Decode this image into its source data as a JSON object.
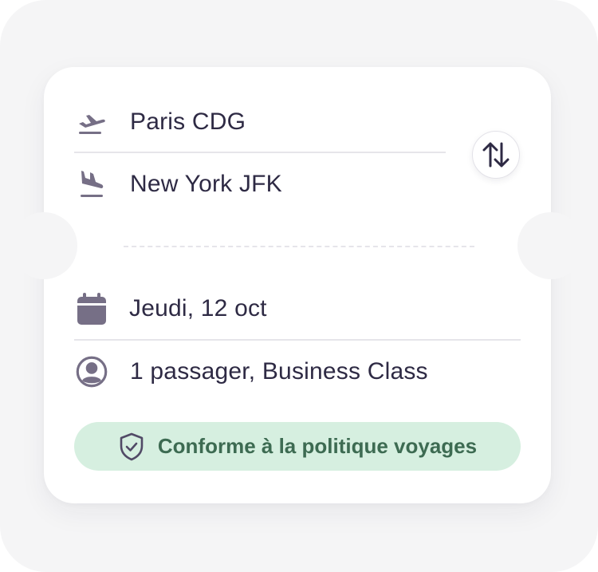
{
  "search_card": {
    "origin": {
      "value": "Paris CDG",
      "icon": "takeoff-icon"
    },
    "destination": {
      "value": "New York JFK",
      "icon": "landing-icon"
    },
    "swap_icon": "swap-vertical-icon",
    "date": {
      "value": "Jeudi, 12 oct",
      "icon": "calendar-icon"
    },
    "passengers": {
      "value": "1 passager, Business Class",
      "icon": "user-circle-icon"
    },
    "policy": {
      "label": "Conforme à la politique voyages",
      "icon": "shield-check-icon"
    }
  },
  "colors": {
    "text": "#2e2a44",
    "icon": "#766f86",
    "divider": "#e6e5ea",
    "policy_bg": "#d6efe0",
    "policy_text": "#3d6b52",
    "background": "#f5f5f6"
  }
}
